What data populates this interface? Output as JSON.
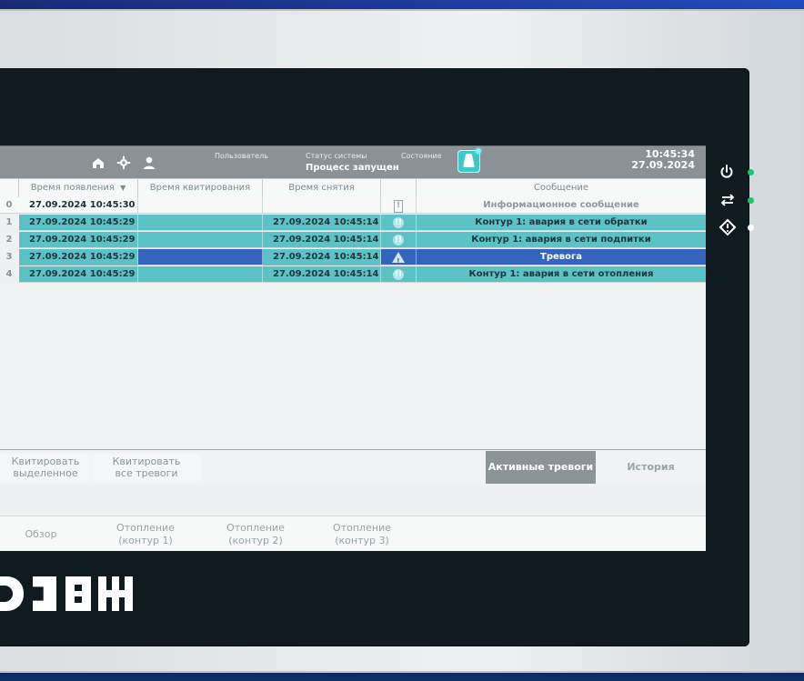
{
  "header": {
    "user_label": "Пользователь",
    "system_status_label": "Статус системы",
    "system_status_value": "Процесс запущен",
    "state_label": "Состояние",
    "time": "10:45:34",
    "date": "27.09.2024"
  },
  "table": {
    "columns": [
      "",
      "Время появления",
      "Время квитирования",
      "Время снятия",
      "",
      "Сообщение"
    ],
    "rows": [
      {
        "id": "0",
        "appearance_time": "27.09.2024 10:45:30",
        "ack_time": "",
        "clear_time": "",
        "icon": "info-icon",
        "message": "Информационное сообщение",
        "style": "info"
      },
      {
        "id": "1",
        "appearance_time": "27.09.2024 10:45:29",
        "ack_time": "",
        "clear_time": "27.09.2024 10:45:14",
        "icon": "warning-double-icon",
        "message": "Контур 1: авария в сети обратки",
        "style": "teal"
      },
      {
        "id": "2",
        "appearance_time": "27.09.2024 10:45:29",
        "ack_time": "",
        "clear_time": "27.09.2024 10:45:14",
        "icon": "warning-double-icon",
        "message": "Контур 1: авария в сети подпитки",
        "style": "teal"
      },
      {
        "id": "3",
        "appearance_time": "27.09.2024 10:45:29",
        "ack_time": "",
        "clear_time": "27.09.2024 10:45:14",
        "icon": "alarm-triangle-icon",
        "message": "Тревога",
        "style": "blue"
      },
      {
        "id": "4",
        "appearance_time": "27.09.2024 10:45:29",
        "ack_time": "",
        "clear_time": "27.09.2024 10:45:14",
        "icon": "warning-double-icon",
        "message": "Контур 1: авария в сети отопления",
        "style": "teal"
      }
    ]
  },
  "toolbar": {
    "ack_selected": "Квитировать\nвыделенное",
    "ack_all": "Квитировать\nвсе тревоги",
    "active_alarms": "Активные тревоги",
    "history": "История"
  },
  "nav": {
    "overview": "Обзор",
    "heating_1": "Отопление\n(контур 1)",
    "heating_2": "Отопление\n(контур 2)",
    "heating_3": "Отопление\n(контур 3)"
  },
  "colors": {
    "teal_row": "#5bc3c5",
    "blue_row": "#3464bd",
    "active_tab": "#8b9497",
    "header_gray": "#8a9296",
    "green_led": "#18c96b",
    "white_led": "#ffffff"
  },
  "icons": {
    "home": "home-icon",
    "settings": "gear-icon",
    "user": "user-icon",
    "power": "power-icon",
    "exchange": "exchange-icon",
    "warning": "warning-icon"
  }
}
